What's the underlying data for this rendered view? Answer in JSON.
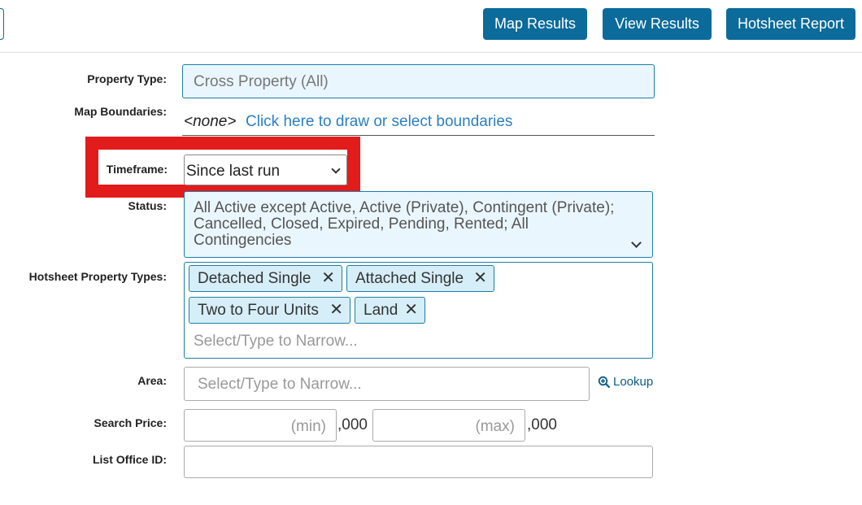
{
  "toolbar": {
    "map_results": "Map Results",
    "view_results": "View Results",
    "hotsheet_report": "Hotsheet Report"
  },
  "form": {
    "property_type": {
      "label": "Property Type:",
      "value": "Cross Property (All)"
    },
    "map_boundaries": {
      "label": "Map Boundaries:",
      "none": "<none>",
      "link": "Click here to draw or select boundaries"
    },
    "timeframe": {
      "label": "Timeframe:",
      "value": "Since last run"
    },
    "status": {
      "label": "Status:",
      "line1": "All Active except Active, Active (Private), Contingent (Private);",
      "line2": "Cancelled, Closed, Expired, Pending, Rented; All",
      "line3": "Contingencies"
    },
    "hotsheet_types": {
      "label": "Hotsheet Property Types:",
      "chips": [
        "Detached Single",
        "Attached Single",
        "Two to Four Units",
        "Land"
      ],
      "placeholder": "Select/Type to Narrow..."
    },
    "area": {
      "label": "Area:",
      "placeholder": "Select/Type to Narrow...",
      "lookup": "Lookup"
    },
    "search_price": {
      "label": "Search Price:",
      "min_placeholder": "(min)",
      "max_placeholder": "(max)",
      "suffix": ",000"
    },
    "list_office": {
      "label": "List Office ID:"
    }
  }
}
